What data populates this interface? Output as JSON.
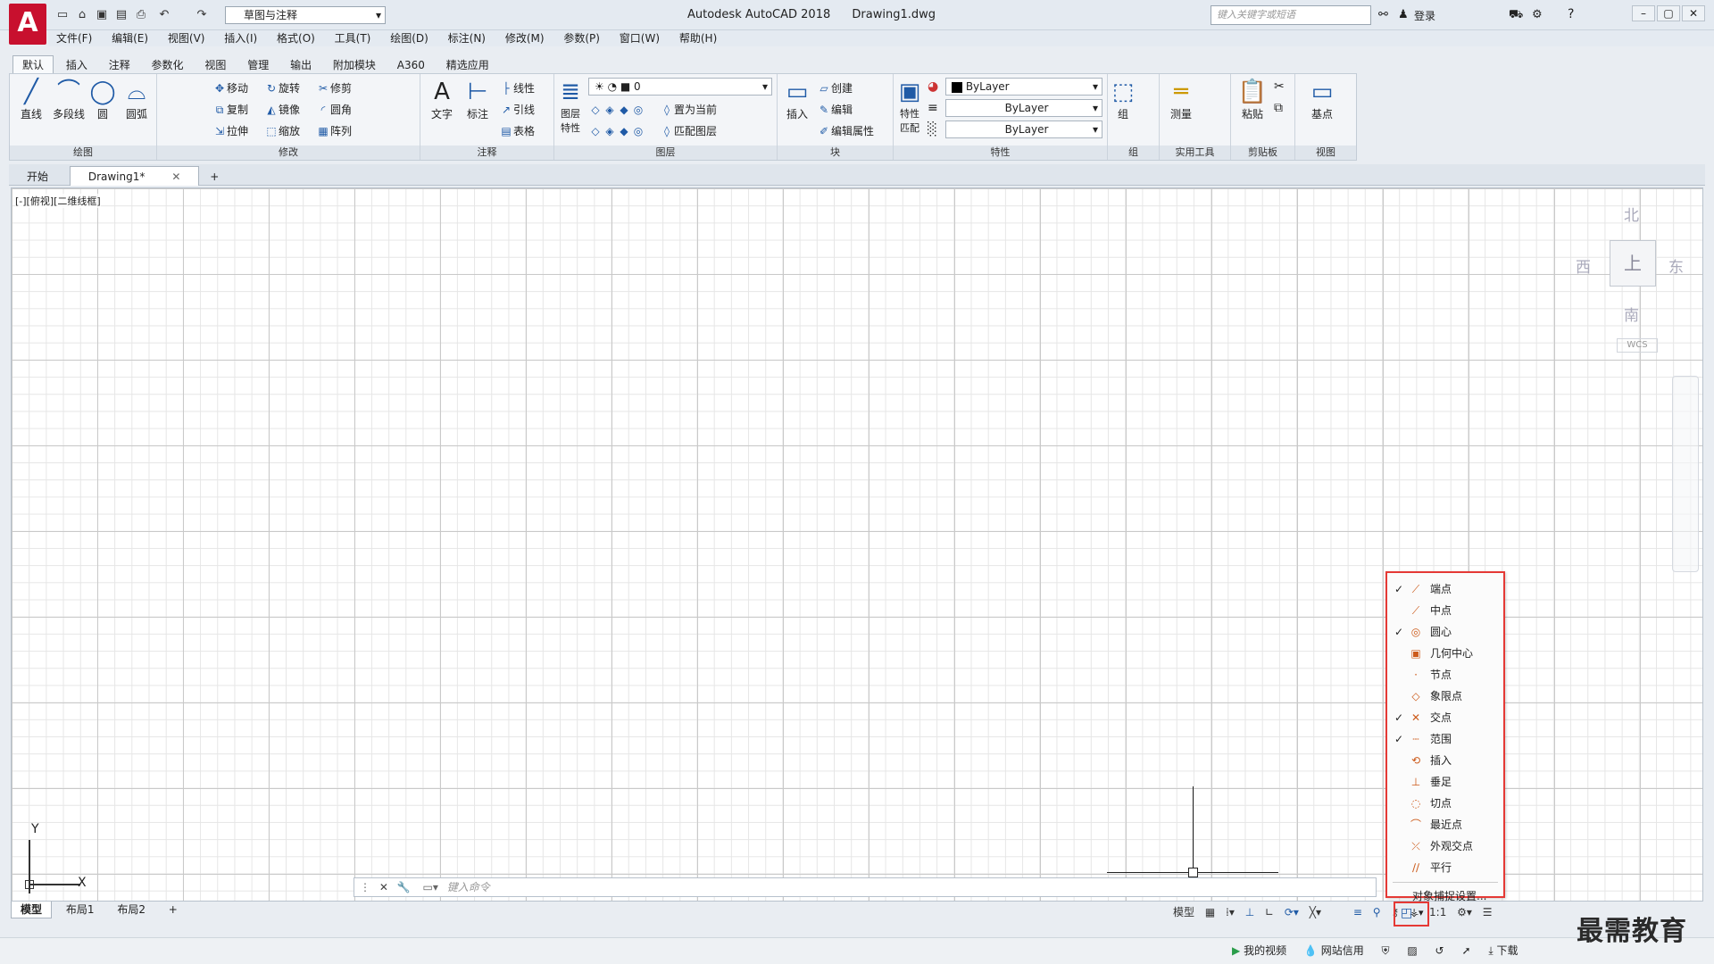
{
  "window": {
    "app_title": "Autodesk AutoCAD 2018",
    "file_name": "Drawing1.dwg",
    "workspace": "草图与注释",
    "search_placeholder": "键入关键字或短语",
    "login": "登录"
  },
  "menu": [
    "文件(F)",
    "编辑(E)",
    "视图(V)",
    "插入(I)",
    "格式(O)",
    "工具(T)",
    "绘图(D)",
    "标注(N)",
    "修改(M)",
    "参数(P)",
    "窗口(W)",
    "帮助(H)"
  ],
  "ribbon_tabs": [
    "默认",
    "插入",
    "注释",
    "参数化",
    "视图",
    "管理",
    "输出",
    "附加模块",
    "A360",
    "精选应用"
  ],
  "panels": {
    "draw": {
      "title": "绘图",
      "tools": [
        "直线",
        "多段线",
        "圆",
        "圆弧"
      ]
    },
    "modify": {
      "title": "修改",
      "tools": [
        "移动",
        "旋转",
        "修剪",
        "复制",
        "镜像",
        "圆角",
        "拉伸",
        "缩放",
        "阵列"
      ]
    },
    "annotation": {
      "title": "注释",
      "tools": [
        "文字",
        "标注",
        "线性",
        "引线",
        "表格"
      ]
    },
    "layers": {
      "title": "图层",
      "layer_props": "图层\n特性",
      "current_layer": "0",
      "set_current": "置为当前",
      "match_layer": "匹配图层"
    },
    "block": {
      "title": "块",
      "insert": "插入",
      "create": "创建",
      "edit": "编辑",
      "edit_attr": "编辑属性"
    },
    "properties": {
      "title": "特性",
      "match": "特性\n匹配",
      "color": "ByLayer",
      "linetype": "ByLayer",
      "lineweight": "ByLayer"
    },
    "groups": {
      "title": "组",
      "group": "组"
    },
    "utilities": {
      "title": "实用工具",
      "measure": "测量"
    },
    "clipboard": {
      "title": "剪贴板",
      "paste": "粘贴"
    },
    "view": {
      "title": "视图",
      "base": "基点"
    }
  },
  "doc_tabs": [
    "开始",
    "Drawing1*"
  ],
  "viewport_label": "[-][俯视][二维线框]",
  "viewcube": {
    "north": "北",
    "south": "南",
    "east": "东",
    "west": "西",
    "top": "上",
    "wcs": "WCS"
  },
  "ucs": {
    "x": "X",
    "y": "Y"
  },
  "command_placeholder": "键入命令",
  "layout_tabs": [
    "模型",
    "布局1",
    "布局2"
  ],
  "statusbar": {
    "model": "模型",
    "scale": "1:1"
  },
  "osnap_menu": {
    "items": [
      {
        "label": "端点",
        "checked": true,
        "icon": "endpoint-icon"
      },
      {
        "label": "中点",
        "checked": false,
        "icon": "midpoint-icon"
      },
      {
        "label": "圆心",
        "checked": true,
        "icon": "center-icon"
      },
      {
        "label": "几何中心",
        "checked": false,
        "icon": "geometric-center-icon"
      },
      {
        "label": "节点",
        "checked": false,
        "icon": "node-icon"
      },
      {
        "label": "象限点",
        "checked": false,
        "icon": "quadrant-icon"
      },
      {
        "label": "交点",
        "checked": true,
        "icon": "intersection-icon"
      },
      {
        "label": "范围",
        "checked": true,
        "icon": "extension-icon"
      },
      {
        "label": "插入",
        "checked": false,
        "icon": "insertion-icon"
      },
      {
        "label": "垂足",
        "checked": false,
        "icon": "perpendicular-icon"
      },
      {
        "label": "切点",
        "checked": false,
        "icon": "tangent-icon"
      },
      {
        "label": "最近点",
        "checked": false,
        "icon": "nearest-icon"
      },
      {
        "label": "外观交点",
        "checked": false,
        "icon": "apparent-intersection-icon"
      },
      {
        "label": "平行",
        "checked": false,
        "icon": "parallel-icon"
      }
    ],
    "settings": "对象捕捉设置..."
  },
  "taskbar": {
    "my_video": "我的视频",
    "net_credit": "网站信用",
    "download": "下载"
  },
  "watermark": "最需教育",
  "colors": {
    "highlight": "#e53935",
    "accent": "#1f5aa6"
  }
}
